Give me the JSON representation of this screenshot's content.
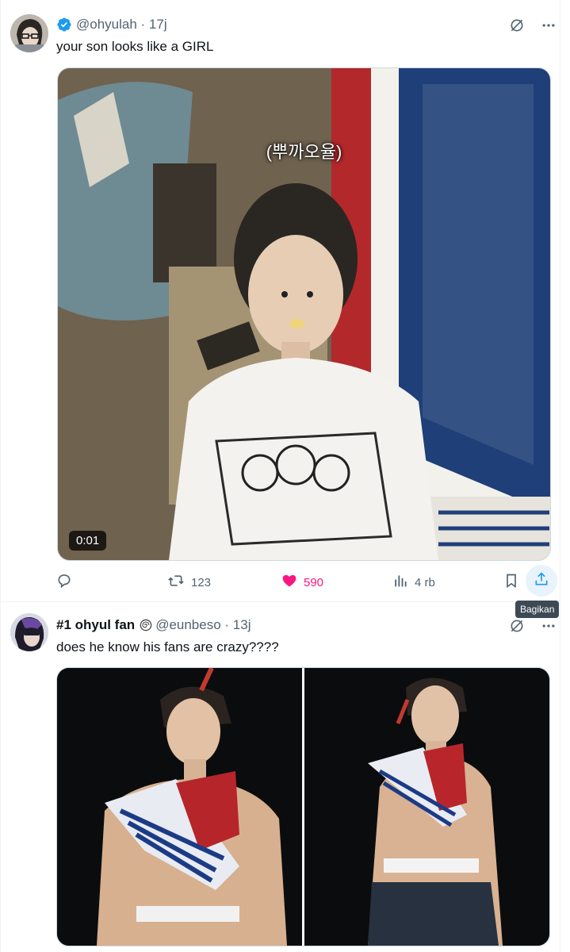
{
  "tweet1": {
    "handle": "@ohyulah",
    "time": "17j",
    "text": "your son looks like a GIRL",
    "video": {
      "caption": "(뿌까오율)",
      "duration": "0:01"
    },
    "stats": {
      "retweets": "123",
      "likes": "590",
      "views": "4 rb"
    },
    "share_tooltip": "Bagikan",
    "colors": {
      "like": "#f91880",
      "verified": "#1d9bf0",
      "muted": "#536471"
    }
  },
  "tweet2": {
    "display_name": "#1 ohyul fan",
    "handle": "@eunbeso",
    "time": "13j",
    "text": "does he know his fans are crazy????"
  }
}
